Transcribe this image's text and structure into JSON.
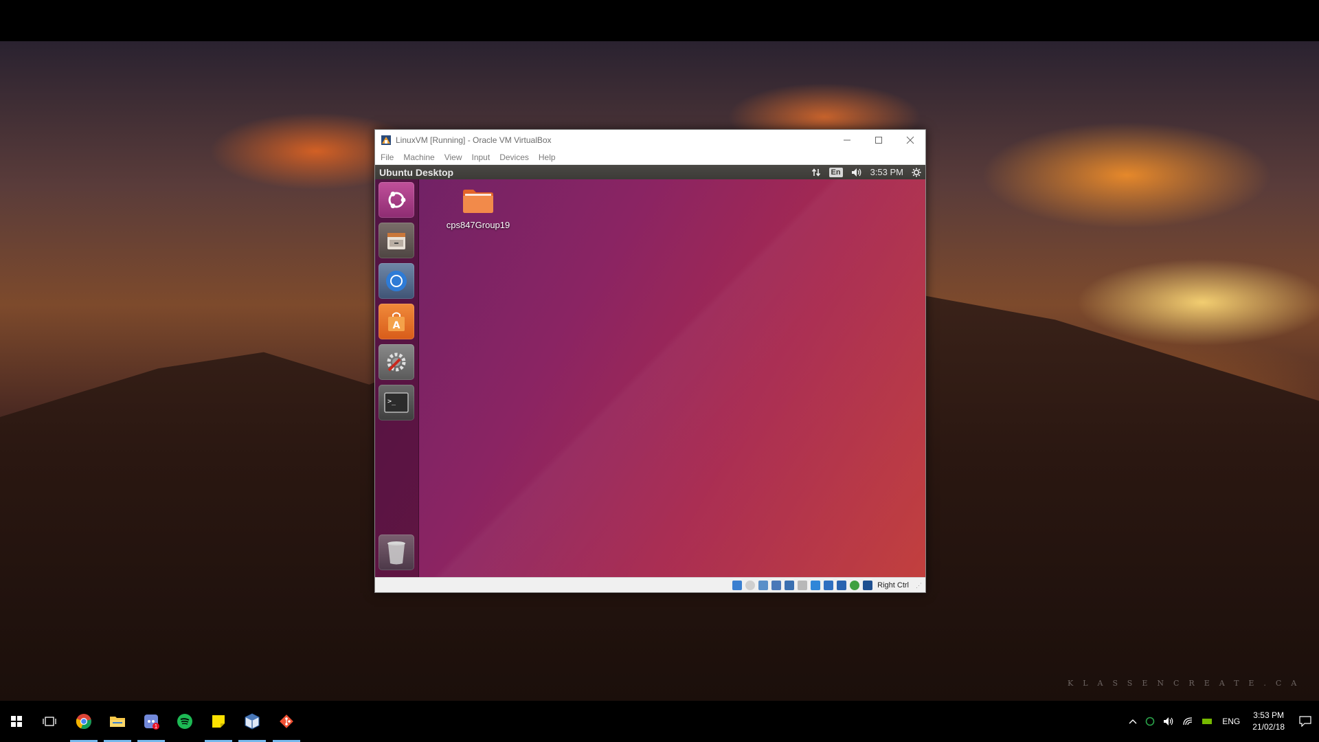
{
  "host": {
    "wallpaper_watermark": "KLASSENCREATE.CA"
  },
  "vbox": {
    "title": "LinuxVM [Running] - Oracle VM VirtualBox",
    "menu": [
      "File",
      "Machine",
      "View",
      "Input",
      "Devices",
      "Help"
    ],
    "status_bar": {
      "icons": [
        "hard-disk-icon",
        "optical-drive-icon",
        "audio-icon",
        "network-icon",
        "usb-icon",
        "shared-folders-icon",
        "display-icon",
        "video-capture-icon",
        "mouse-integration-icon",
        "keyboard-icon",
        "cpu-icon"
      ],
      "host_key": "Right Ctrl"
    }
  },
  "ubuntu": {
    "panel_title": "Ubuntu Desktop",
    "indicators": {
      "network_icon": "network-updown-icon",
      "keyboard_lang": "En",
      "sound_icon": "volume-icon",
      "clock": "3:53 PM",
      "session_icon": "gear-icon"
    },
    "launcher": [
      "dash-home",
      "files",
      "chromium",
      "ubuntu-software",
      "system-settings",
      "terminal",
      "trash"
    ],
    "desktop_items": [
      {
        "label": "cps847Group19",
        "icon": "folder-icon"
      }
    ]
  },
  "taskbar": {
    "apps": [
      "start",
      "task-view",
      "chrome",
      "file-explorer",
      "discord",
      "spotify",
      "sticky-notes",
      "virtualbox",
      "git"
    ],
    "discord_badge": "1",
    "tray": {
      "language": "ENG",
      "time": "3:53 PM",
      "date": "21/02/18"
    }
  },
  "colors": {
    "taskbar_accent": "#76b9ed",
    "ubuntu_panel": "#3c3b37",
    "ubuntu_bg_start": "#6d2266",
    "ubuntu_bg_end": "#c2403e"
  }
}
